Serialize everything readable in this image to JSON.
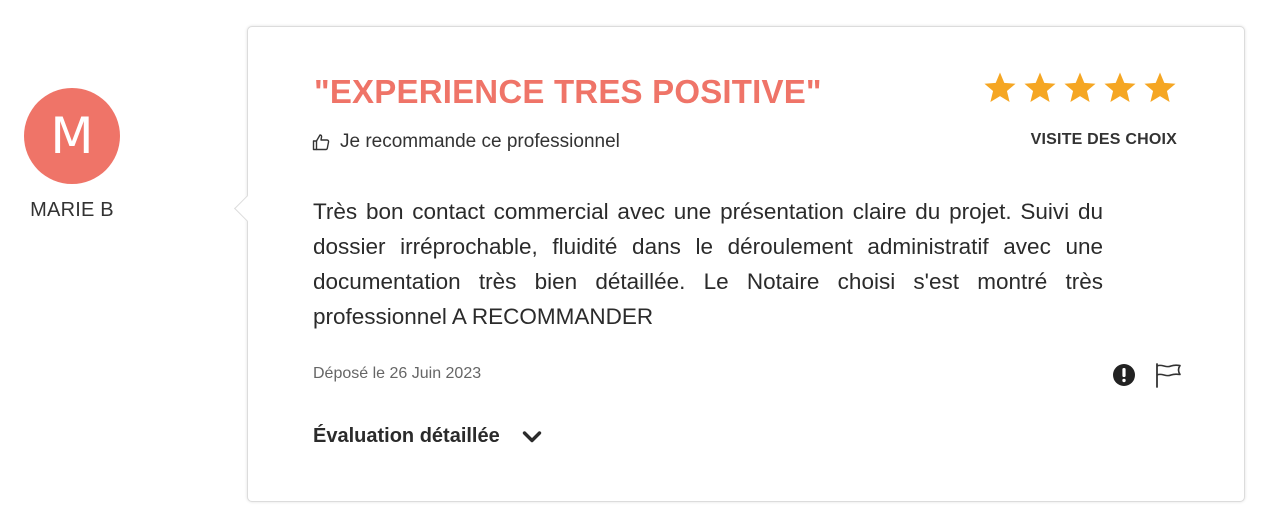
{
  "reviewer": {
    "initial": "M",
    "name": "MARIE B"
  },
  "review": {
    "title": "\"EXPERIENCE TRES POSITIVE\"",
    "recommend_text": "Je recommande ce professionnel",
    "rating": 5,
    "rating_max": 5,
    "visit_type": "VISITE DES CHOIX",
    "body": "Très bon contact commercial avec une présentation claire du projet. Suivi du dossier irréprochable, fluidité dans le déroulement administratif avec une documentation très bien détaillée. Le Notaire choisi s'est montré très professionnel A RECOMMANDER",
    "posted_date": "Déposé le 26 Juin 2023",
    "detailed_label": "Évaluation détaillée"
  },
  "icons": {
    "thumb": "thumbs-up-icon",
    "star": "star-icon",
    "report": "exclamation-icon",
    "flag": "flag-icon",
    "expand": "chevron-down-icon"
  },
  "colors": {
    "accent": "#ef7468",
    "star": "#f5a623",
    "text": "#2b2b2b",
    "muted": "#666666"
  }
}
